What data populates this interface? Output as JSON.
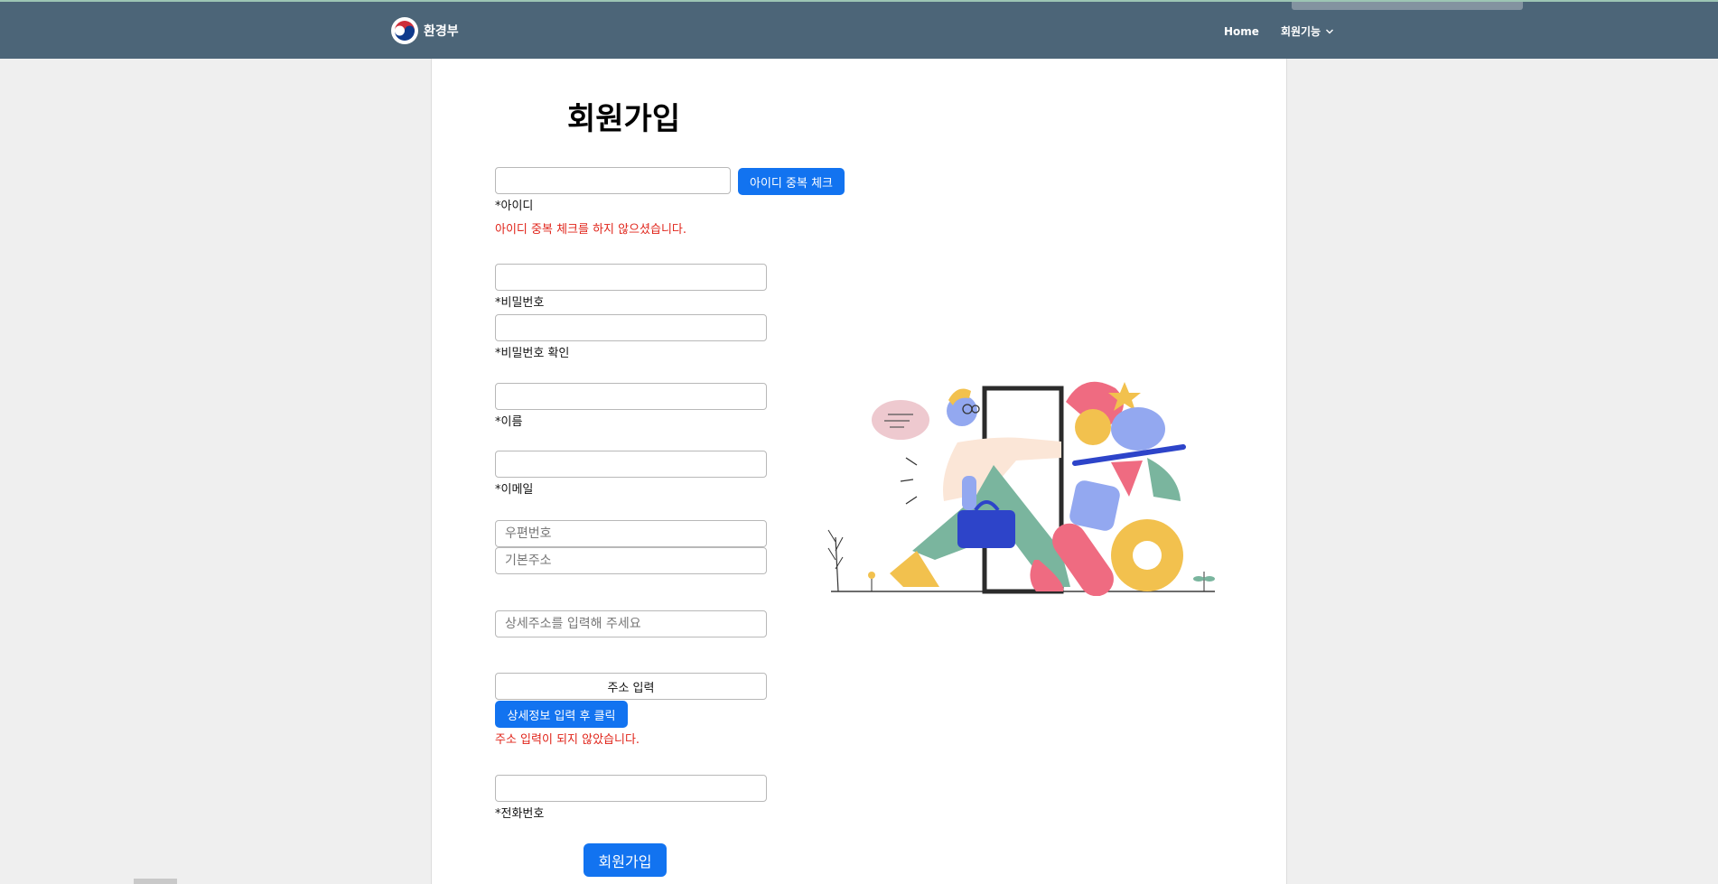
{
  "nav": {
    "brand": "환경부",
    "links": [
      {
        "label": "Home"
      },
      {
        "label": "회원기능"
      }
    ]
  },
  "form": {
    "title": "회원가입",
    "id": {
      "value": "",
      "label": "*아이디",
      "check_button": "아이디 중복 체크",
      "error": "아이디 중복 체크를 하지 않으셨습니다."
    },
    "password": {
      "value": "",
      "label": "*비밀번호"
    },
    "password_confirm": {
      "value": "",
      "label": "*비밀번호 확인"
    },
    "name": {
      "value": "",
      "label": "*이름"
    },
    "email": {
      "value": "",
      "label": "*이메일"
    },
    "address": {
      "zip_placeholder": "우편번호",
      "base_placeholder": "기본주소",
      "detail_placeholder": "상세주소를 입력해 주세요",
      "input_button": "주소 입력",
      "confirm_button": "상세정보 입력 후 클릭",
      "error": "주소 입력이 되지 않았습니다."
    },
    "phone": {
      "value": "",
      "label": "*전화번호"
    },
    "submit": "회원가입"
  },
  "colors": {
    "navbar": "#4c6578",
    "primary": "#1273f0",
    "error": "#e0241a"
  }
}
